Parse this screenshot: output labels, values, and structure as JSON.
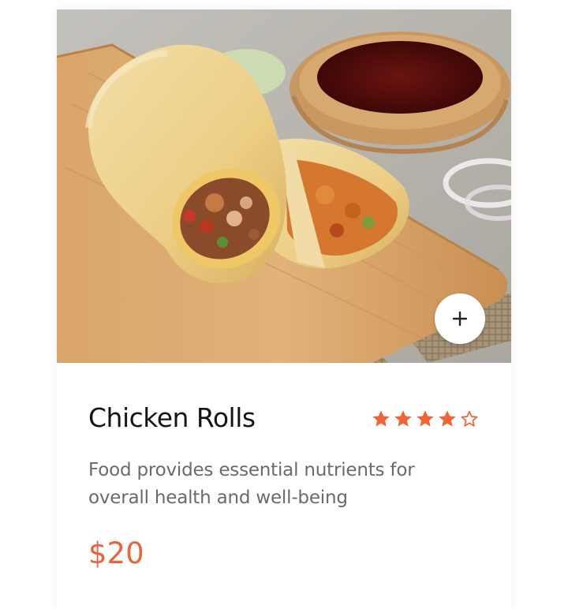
{
  "product": {
    "image_alt": "Chicken rolls on a wooden board with dipping sauce",
    "add_button_label": "+",
    "title": "Chicken Rolls",
    "rating": {
      "value": 4,
      "max": 5,
      "filled_color": "#f0643a",
      "empty_color": "#f0643a"
    },
    "description": "Food provides essential nutrients for overall health and well-being",
    "price": "$20",
    "price_color": "#e8643c",
    "icons": {
      "add": "plus-icon",
      "star_filled": "star-filled-icon",
      "star_empty": "star-outline-icon"
    }
  }
}
